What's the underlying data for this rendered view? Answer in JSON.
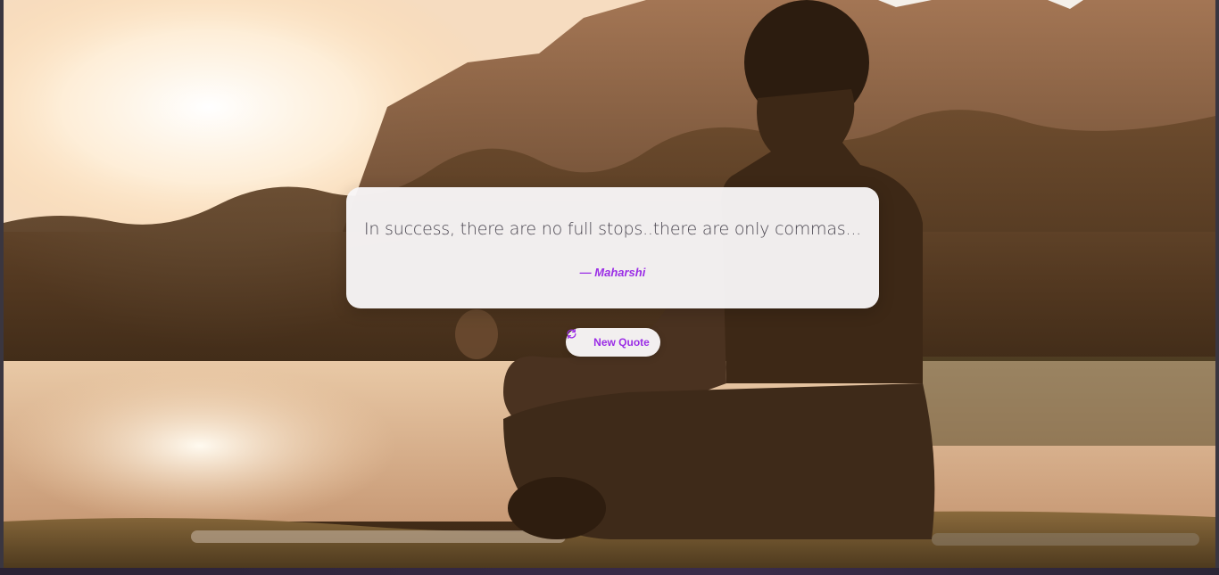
{
  "quote": {
    "text": "In success, there are no full stops..there are only commas...",
    "author": "— Maharshi"
  },
  "controls": {
    "new_quote_label": "New Quote",
    "new_quote_icon": "refresh-icon"
  },
  "colors": {
    "accent": "#9b2ee6",
    "card_bg": "#f8f6f7",
    "quote_text": "#4a4650"
  },
  "background": {
    "description_icon": "meditation-sunset-photo"
  }
}
